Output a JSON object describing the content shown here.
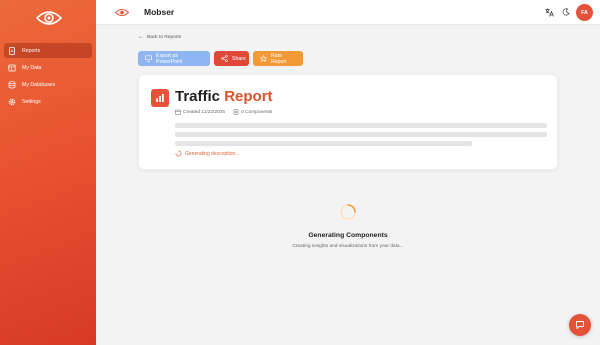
{
  "app": {
    "name": "Mobser"
  },
  "sidebar": {
    "items": [
      {
        "label": "Reports",
        "icon": "document-icon",
        "active": true
      },
      {
        "label": "My Data",
        "icon": "table-icon",
        "active": false
      },
      {
        "label": "My Databases",
        "icon": "database-icon",
        "active": false
      },
      {
        "label": "Settings",
        "icon": "gear-icon",
        "active": false
      }
    ]
  },
  "header": {
    "avatar_initials": "FA"
  },
  "back_link": "Back to Reports",
  "actions": {
    "export_label": "Export as PowerPoint",
    "share_label": "Share",
    "rate_label": "Rate Report"
  },
  "report": {
    "title_first": "Traffic",
    "title_second": "Report",
    "created": "Created 11/22/2025",
    "components": "0 Components",
    "generating_description": "Generating description..."
  },
  "status": {
    "title": "Generating Components",
    "subtitle": "Creating insights and visualizations from your data..."
  },
  "colors": {
    "accent": "#e5523a",
    "sidebar_top": "#ec6a3b",
    "sidebar_bottom": "#d63a26",
    "export_button": "#8fb6f0",
    "share_button": "#e0493a",
    "rate_button": "#f39a38"
  }
}
